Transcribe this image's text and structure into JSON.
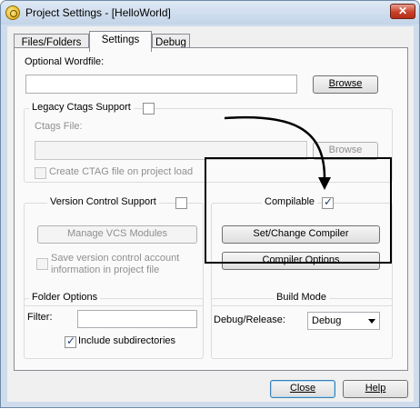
{
  "window": {
    "title": "Project Settings - [HelloWorld]",
    "close_glyph": "✕"
  },
  "tabs": [
    {
      "label": "Files/Folders",
      "active": false
    },
    {
      "label": "Settings",
      "active": true
    },
    {
      "label": "Debug",
      "active": false
    }
  ],
  "settings": {
    "optional_wordfile_label": "Optional Wordfile:",
    "optional_wordfile_value": "",
    "browse_label": "Browse",
    "legacy_ctags_label": "Legacy Ctags Support",
    "legacy_ctags_checked": false,
    "ctags_file_label": "Ctags File:",
    "ctags_file_value": "",
    "ctags_browse_label": "Browse",
    "create_ctag_label": "Create CTAG file on project load",
    "create_ctag_checked": false,
    "vcs_label": "Version Control Support",
    "vcs_checked": false,
    "manage_vcs_label": "Manage VCS Modules",
    "save_vcs_label_line1": "Save version control account",
    "save_vcs_label_line2": "information in project file",
    "save_vcs_checked": false,
    "compilable_label": "Compilable",
    "compilable_checked": true,
    "set_compiler_label": "Set/Change Compiler",
    "compiler_options_label": "Compiler Options",
    "folder_options_label": "Folder Options",
    "filter_label": "Filter:",
    "filter_value": "",
    "include_subdirs_label": "Include subdirectories",
    "include_subdirs_checked": true,
    "build_mode_label": "Build Mode",
    "debug_release_label": "Debug/Release:",
    "debug_release_value": "Debug"
  },
  "footer": {
    "close_label": "Close",
    "help_label": "Help"
  },
  "annotation": {
    "color": "#000000"
  }
}
